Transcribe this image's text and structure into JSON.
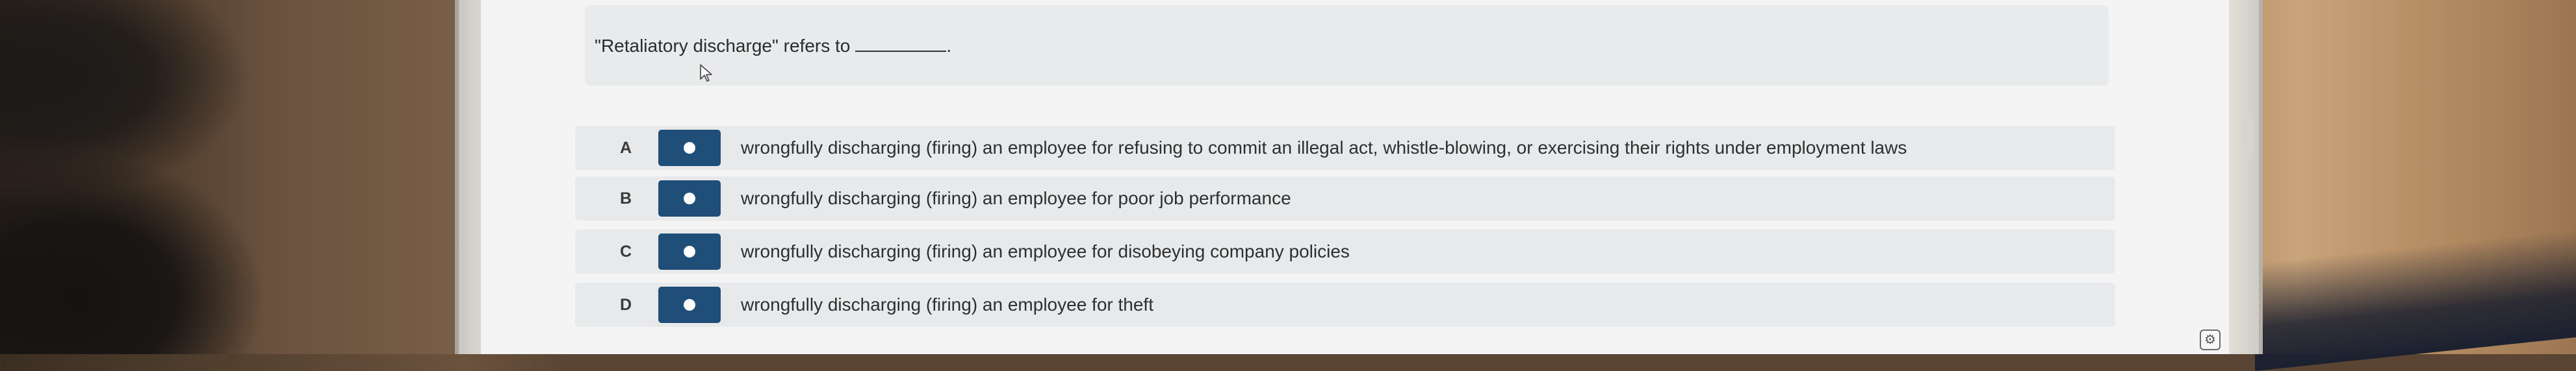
{
  "question": {
    "prompt": "\"Retaliatory discharge\" refers to",
    "end_punct": "."
  },
  "options": [
    {
      "letter": "A",
      "text": "wrongfully discharging (firing) an employee for refusing to commit an illegal act, whistle-blowing, or exercising their rights under employment laws"
    },
    {
      "letter": "B",
      "text": "wrongfully discharging (firing) an employee for poor job performance"
    },
    {
      "letter": "C",
      "text": "wrongfully discharging (firing) an employee for disobeying company policies"
    },
    {
      "letter": "D",
      "text": "wrongfully discharging (firing) an employee for theft"
    }
  ],
  "colors": {
    "toggle": "#1f4e79",
    "option_bg": "#e8e9ea",
    "question_bg": "#e9eaeb"
  },
  "icons": {
    "cursor": "mouse-cursor-icon",
    "corner": "settings-icon"
  }
}
